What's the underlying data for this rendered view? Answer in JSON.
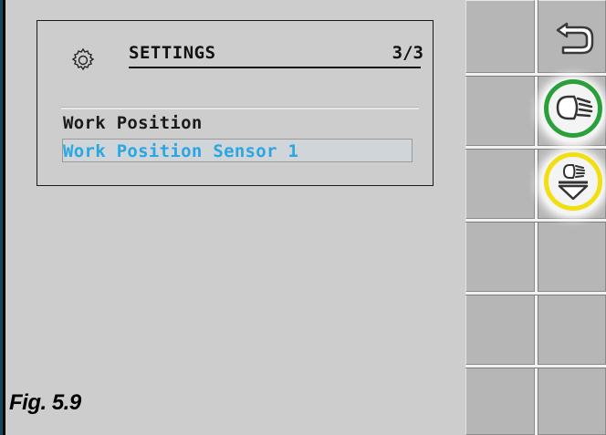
{
  "settings": {
    "title": "SETTINGS",
    "page_indicator": "3/3",
    "items": [
      {
        "label": "Work Position",
        "selected": false
      },
      {
        "label": "Work Position Sensor 1",
        "selected": true
      }
    ]
  },
  "figure_label": "Fig. 5.9",
  "side_buttons": {
    "back": {
      "icon": "back-arrow-icon"
    },
    "light_toggle": {
      "icon": "headlight-icon",
      "highlight_color": "#2aa03a"
    },
    "light_sensor": {
      "icon": "headlight-down-icon",
      "highlight_color": "#f2df12"
    }
  },
  "colors": {
    "selected_text": "#2aa6e0",
    "background": "#cdcdcd",
    "panel": "#b6b6b6"
  }
}
